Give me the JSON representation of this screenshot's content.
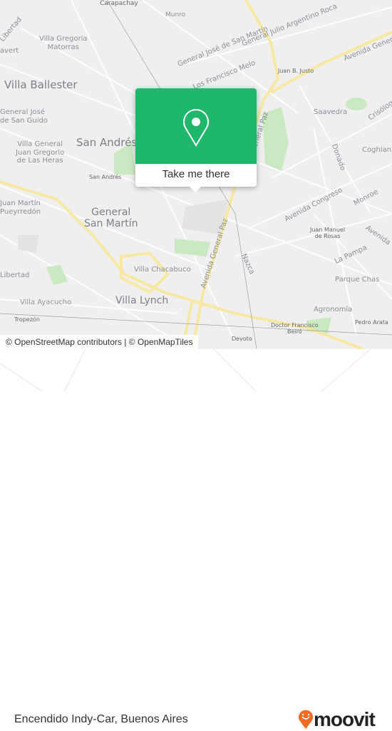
{
  "map": {
    "labels": {
      "carapachay": "Carapachay",
      "munro": "Munro",
      "villa_gregoria_1": "Villa Gregoria",
      "villa_gregoria_2": "Matorras",
      "villa_ballester": "Villa Ballester",
      "gral_san_martin_road": "General José de San Martín",
      "gral_roca": "General Julio Argentino Roca",
      "francisco_melo": "Los Francisco Melo",
      "juan_b_justo": "Juan B. Justo",
      "avenida_ne": "Avenida General",
      "saavedra": "Saavedra",
      "crisologo": "Crisólogo",
      "coghlan": "Coghlan",
      "donado": "Donado",
      "gral_jose_1": "General José",
      "gral_jose_2": "de San Guido",
      "vgjgh_1": "Villa General",
      "vgjgh_2": "Juan Gregorio",
      "vgjgh_3": "de Las Heras",
      "san_andres_big": "San Andrés",
      "san_andres_small": "San Andrés",
      "juan_martin_1": "Juan Martín",
      "juan_martin_2": "Pueyrredón",
      "general_san_martin_1": "General",
      "general_san_martin_2": "San Martín",
      "av_general_paz_n": "General Paz",
      "av_congreso": "Avenida Congreso",
      "monroe": "Monroe",
      "avenida_e": "Avenida",
      "juan_manuel_1": "Juan Manuel",
      "juan_manuel_2": "de Rosas",
      "la_pampa": "La Pampa",
      "parque_chas": "Parque Chas",
      "nazca": "Nazca",
      "av_general_paz": "Avenida General Paz",
      "villa_chacabuco": "Villa Chacabuco",
      "libertad": "Libertad",
      "villa_lynch": "Villa Lynch",
      "villa_ayacucho": "Villa Ayacucho",
      "tropezon": "Tropezón",
      "agronomia": "Agronomía",
      "pedro_arata": "Pedro Arata",
      "dr_beiro_1": "Doctor Francisco",
      "dr_beiro_2": "Beiró",
      "devoto": "Devoto",
      "libertad_top": "Libertad",
      "avert": "avert"
    },
    "attribution": "© OpenStreetMap contributors | © OpenMapTiles"
  },
  "popup": {
    "icon": "map-pin-icon",
    "button_label": "Take me there",
    "color": "#1fb86a"
  },
  "footer": {
    "place_name": "Encendido Indy-Car, Buenos Aires",
    "logo_text": "moovit",
    "logo_color": "#f26a21"
  }
}
